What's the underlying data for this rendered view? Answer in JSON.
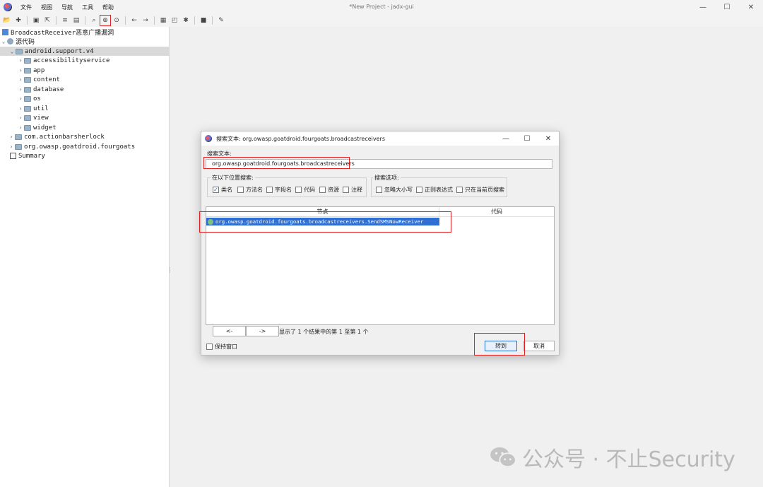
{
  "app": {
    "window_title": "*New Project - jadx-gui",
    "menu": [
      "文件",
      "视图",
      "导航",
      "工具",
      "帮助"
    ],
    "window_controls": [
      "—",
      "☐",
      "✕"
    ]
  },
  "toolbar": {
    "icons": [
      "open-icon",
      "add-files-icon",
      "save-icon",
      "export-icon",
      "sync-icon",
      "flatten-icon",
      "search-icon",
      "text-search-icon",
      "class-search-icon",
      "back-icon",
      "forward-icon",
      "decompile-icon",
      "deobfuscation-icon",
      "log-icon",
      "debug-icon",
      "preferences-icon"
    ],
    "highlighted": "text-search-icon"
  },
  "tree": {
    "root": "BroadcastReceiver恶意广播漏洞",
    "source": "源代码",
    "selected_package": "android.support.v4",
    "children": [
      "accessibilityservice",
      "app",
      "content",
      "database",
      "os",
      "util",
      "view",
      "widget"
    ],
    "packages": [
      "com.actionbarsherlock",
      "org.owasp.goatdroid.fourgoats"
    ],
    "summary": "Summary"
  },
  "dialog": {
    "title": "搜索文本: org.owasp.goatdroid.fourgoats.broadcastreceivers",
    "search_label": "搜索文本:",
    "search_value": "org.owasp.goatdroid.fourgoats.broadcastreceivers",
    "search_in_label": "在以下位置搜索:",
    "search_in": [
      {
        "label": "类名",
        "checked": "✓"
      },
      {
        "label": "方法名",
        "checked": ""
      },
      {
        "label": "字段名",
        "checked": ""
      },
      {
        "label": "代码",
        "checked": ""
      },
      {
        "label": "资源",
        "checked": ""
      },
      {
        "label": "注释",
        "checked": ""
      }
    ],
    "options_label": "搜索选项:",
    "options": [
      {
        "label": "忽略大小写",
        "checked": ""
      },
      {
        "label": "正则表达式",
        "checked": ""
      },
      {
        "label": "只在当前页搜索",
        "checked": ""
      }
    ],
    "columns": [
      "节点",
      "代码"
    ],
    "result": "org.owasp.goatdroid.fourgoats.broadcastreceivers.SendSMSNowReceiver",
    "prev_label": "<-",
    "next_label": "->",
    "status": "显示了 1 个结果中的第 1 至第 1 个",
    "keep_open": "保持窗口",
    "goto_label": "转到",
    "cancel_label": "取消",
    "controls": [
      "—",
      "☐",
      "✕"
    ]
  },
  "watermark": {
    "text": "公众号 · 不止Security"
  },
  "colors": {
    "highlight_red": "#e02020",
    "selection_blue": "#2f6fd3",
    "tree_selected": "#d9d9d9"
  }
}
